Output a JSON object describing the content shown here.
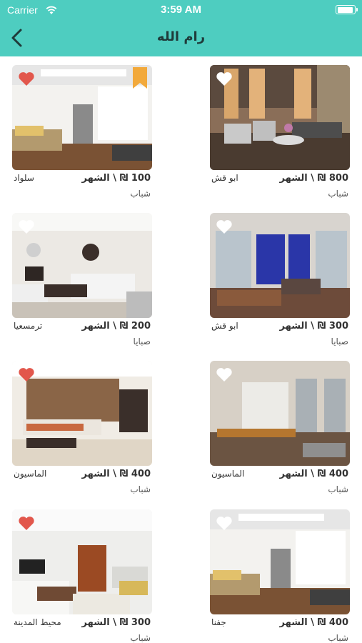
{
  "status": {
    "carrier": "Carrier",
    "time": "3:59 AM"
  },
  "nav": {
    "title": "رام الله",
    "back_icon": "chevron-left-icon"
  },
  "colors": {
    "accent": "#4ecdc0",
    "heart_red": "#e2574c",
    "ribbon": "#f2a93b"
  },
  "listings": [
    {
      "price": "800 ₪ \\ الشهر",
      "area": "ابو قش",
      "type": "شباب",
      "favorite": false,
      "featured": false
    },
    {
      "price": "100 ₪ \\ الشهر",
      "area": "سلواد",
      "type": "شباب",
      "favorite": true,
      "featured": true
    },
    {
      "price": "300 ₪ \\ الشهر",
      "area": "ابو قش",
      "type": "صبايا",
      "favorite": false,
      "featured": false
    },
    {
      "price": "200 ₪ \\ الشهر",
      "area": "ترمسعيا",
      "type": "صبايا",
      "favorite": false,
      "featured": false
    },
    {
      "price": "400 ₪ \\ الشهر",
      "area": "الماسيون",
      "type": "شباب",
      "favorite": false,
      "featured": false
    },
    {
      "price": "400 ₪ \\ الشهر",
      "area": "الماسيون",
      "type": "شباب",
      "favorite": true,
      "featured": false
    },
    {
      "price": "400 ₪ \\ الشهر",
      "area": "جفنا",
      "type": "شباب",
      "favorite": false,
      "featured": false
    },
    {
      "price": "300 ₪ \\ الشهر",
      "area": "محيط المدينة",
      "type": "شباب",
      "favorite": true,
      "featured": false
    }
  ]
}
